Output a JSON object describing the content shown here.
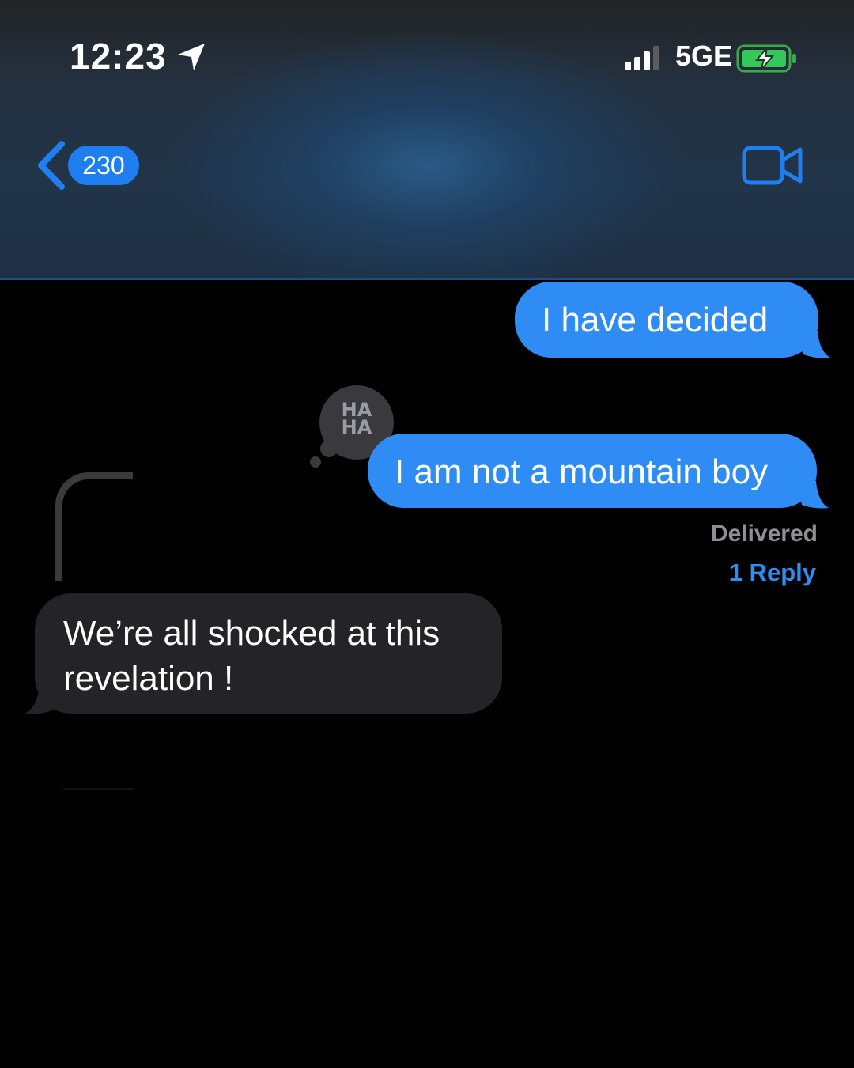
{
  "status_bar": {
    "time": "12:23",
    "network": "5GE",
    "icons": [
      "location-arrow-icon",
      "signal-icon",
      "battery-charging-icon"
    ]
  },
  "nav": {
    "back_count": "230",
    "icons": [
      "chevron-left-icon",
      "video-camera-icon"
    ]
  },
  "colors": {
    "outgoing_bubble": "#2f8cf4",
    "incoming_bubble": "#242428",
    "accent": "#1f7ef0",
    "battery_fill": "#34c759"
  },
  "messages": [
    {
      "direction": "outgoing",
      "text": "I have decided"
    },
    {
      "direction": "outgoing",
      "text": "I am not a mountain boy",
      "tapback": "HA HA"
    },
    {
      "direction": "incoming",
      "text": "We’re all shocked at this revelation !"
    }
  ],
  "delivery_status": "Delivered",
  "replies_label": "1 Reply"
}
